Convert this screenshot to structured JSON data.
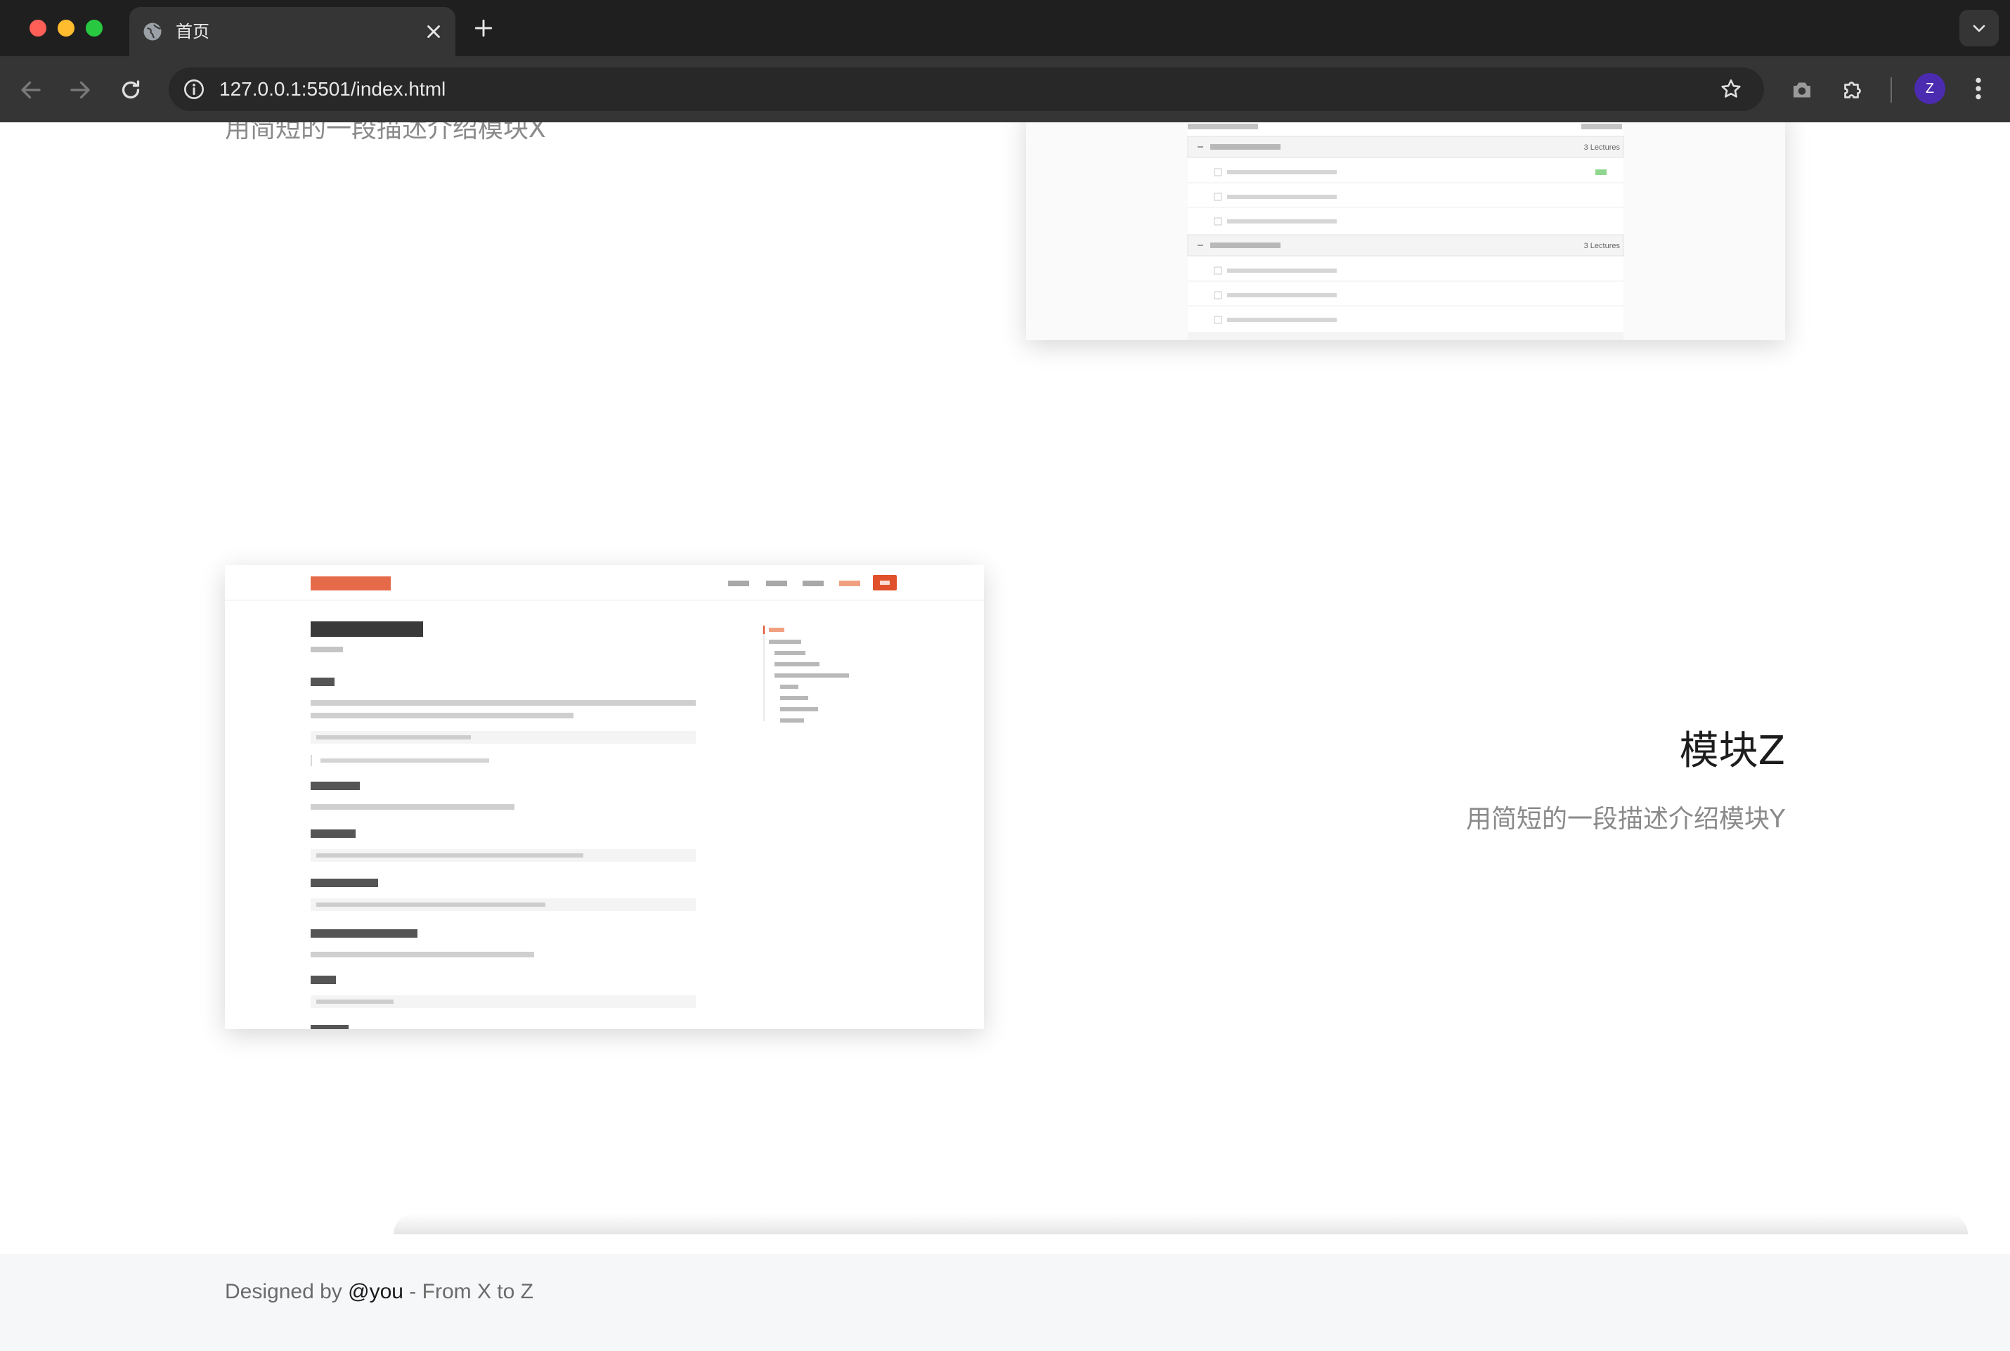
{
  "browser": {
    "tab_title": "首页",
    "url": "127.0.0.1:5501/index.html",
    "profile_initial": "Z"
  },
  "sections": {
    "module_x": {
      "description": "用简短的一段描述介绍模块X"
    },
    "module_z": {
      "title": "模块Z",
      "description": "用简短的一段描述介绍模块Y"
    }
  },
  "course_preview": {
    "section_count_label": "3 Lectures",
    "section_count_label_2": "3 Lectures"
  },
  "footer": {
    "prefix": "Designed by",
    "handle": "@you",
    "suffix": "- From X to Z"
  },
  "colors": {
    "accent": "#e0502a",
    "footer_bg": "#f6f7f9"
  }
}
